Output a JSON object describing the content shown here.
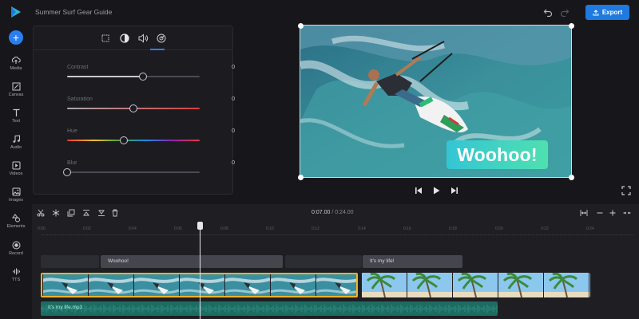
{
  "app": {
    "document_title": "Summer Surf Gear Guide",
    "export_label": "Export",
    "accent": "#1f7ae0"
  },
  "rail": {
    "items": [
      {
        "label": "Media",
        "icon": "upload-cloud-icon"
      },
      {
        "label": "Canvas",
        "icon": "canvas-icon"
      },
      {
        "label": "Text",
        "icon": "text-icon"
      },
      {
        "label": "Audio",
        "icon": "music-note-icon"
      },
      {
        "label": "Videos",
        "icon": "video-play-icon"
      },
      {
        "label": "Images",
        "icon": "image-icon"
      },
      {
        "label": "Elements",
        "icon": "shapes-icon"
      },
      {
        "label": "Record",
        "icon": "record-icon"
      },
      {
        "label": "TTS",
        "icon": "waveform-icon"
      }
    ]
  },
  "panel": {
    "tabs": [
      "crop-icon",
      "contrast-circle-icon",
      "speaker-icon",
      "speed-icon"
    ],
    "active_tab": 1,
    "sliders": [
      {
        "label": "Contrast",
        "value": "0",
        "position": 0.57
      },
      {
        "label": "Saturation",
        "value": "0",
        "position": 0.5
      },
      {
        "label": "Hue",
        "value": "0",
        "position": 0.43
      },
      {
        "label": "Blur",
        "value": "0",
        "position": 0.0
      }
    ]
  },
  "preview": {
    "overlay_text": "Woohoo!"
  },
  "timeline": {
    "current_time": "0:07.00",
    "separator": "/",
    "total_time": "0:24.00",
    "ruler": [
      "0:00",
      "0:02",
      "0:04",
      "0:06",
      "0:08",
      "0:10",
      "0:12",
      "0:14",
      "0:16",
      "0:18",
      "0:20",
      "0:22",
      "0:24"
    ],
    "text_clips": [
      {
        "label": "Woohoo!"
      },
      {
        "label": "It's my life!"
      }
    ],
    "audio_clip": "It's my life.mp3"
  }
}
